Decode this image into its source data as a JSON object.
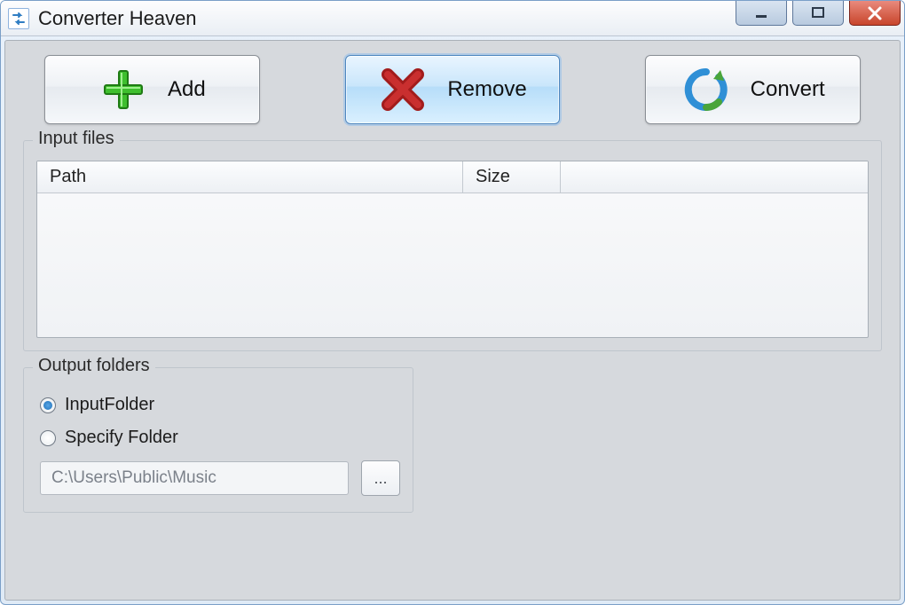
{
  "window": {
    "title": "Converter Heaven"
  },
  "toolbar": {
    "add_label": "Add",
    "remove_label": "Remove",
    "convert_label": "Convert",
    "selected": "remove"
  },
  "input_files": {
    "legend": "Input files",
    "columns": {
      "path": "Path",
      "size": "Size"
    },
    "rows": []
  },
  "output": {
    "legend": "Output folders",
    "options": {
      "input_folder_label": "InputFolder",
      "specify_folder_label": "Specify Folder"
    },
    "selected": "input_folder",
    "path_value": "C:\\Users\\Public\\Music",
    "browse_label": "...",
    "path_enabled": false
  }
}
